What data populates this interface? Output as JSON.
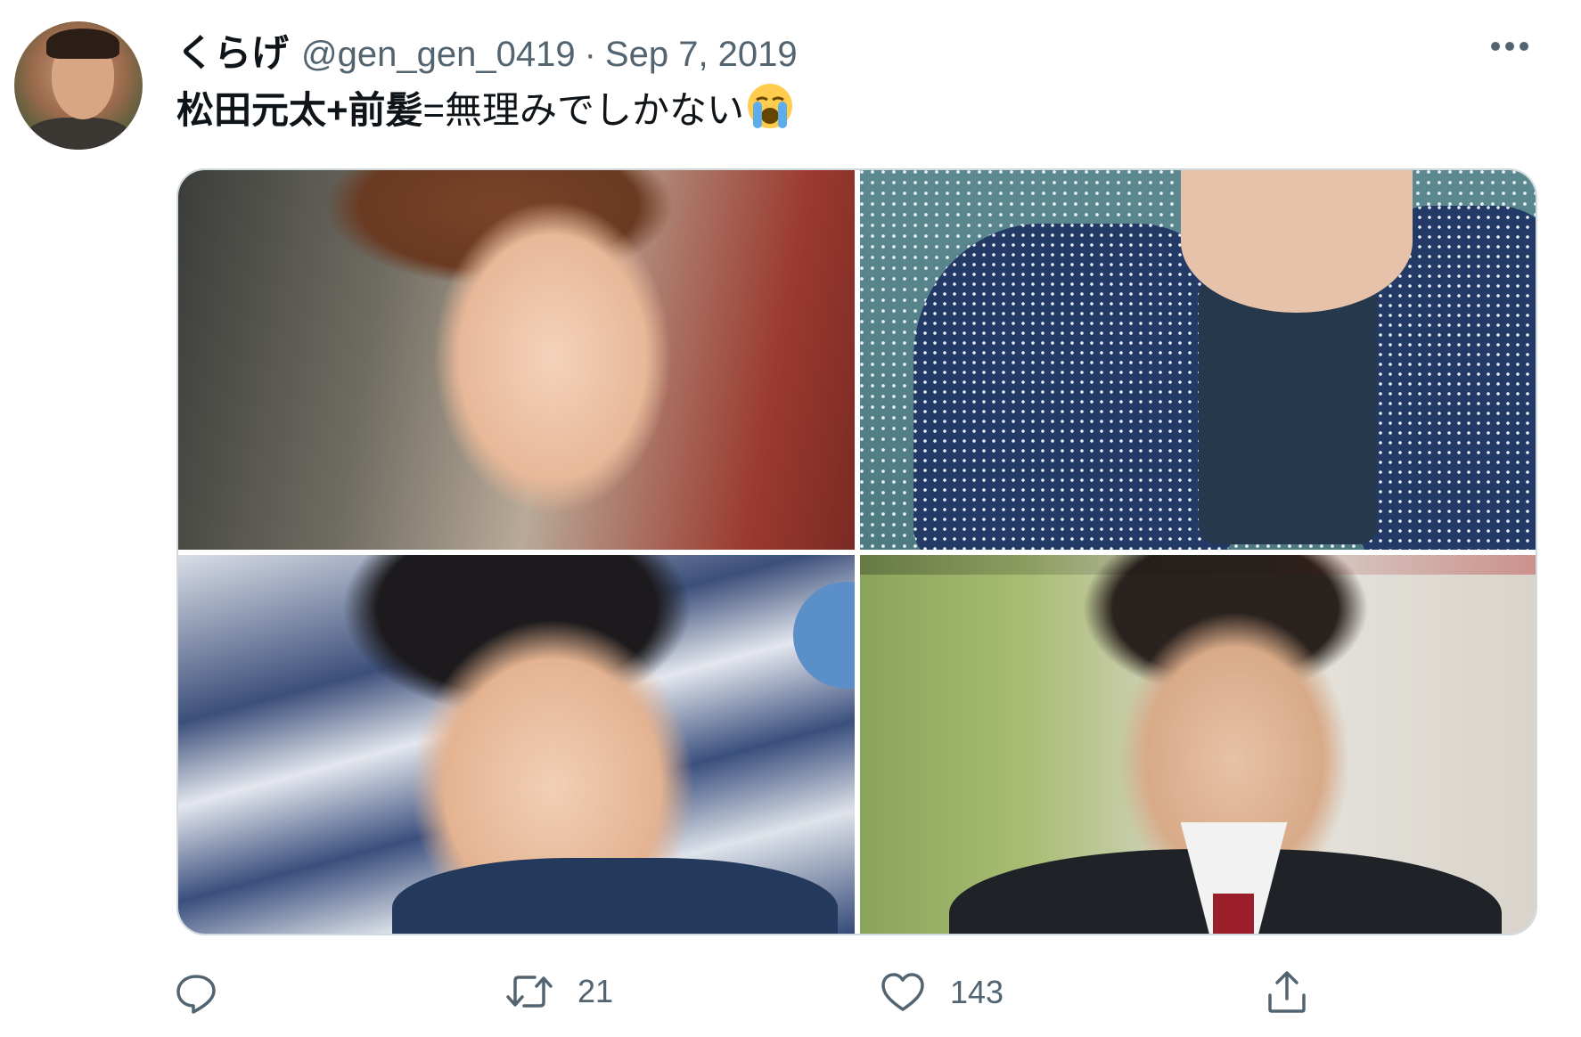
{
  "tweet": {
    "display_name": "くらげ",
    "handle": "@gen_gen_0419",
    "separator": "·",
    "date": "Sep 7, 2019",
    "text_bold": "松田元太+前髪",
    "text_rest": "=無理みでしかない",
    "emoji": "loudly-crying-face-emoji"
  },
  "media": {
    "photos": [
      {
        "name": "photo-1"
      },
      {
        "name": "photo-2"
      },
      {
        "name": "photo-3"
      },
      {
        "name": "photo-4"
      }
    ]
  },
  "actions": {
    "reply_count": "",
    "retweet_count": "21",
    "like_count": "143"
  },
  "icons": {
    "more": "more-horizontal-icon",
    "reply": "reply-icon",
    "retweet": "retweet-icon",
    "like": "heart-icon",
    "share": "share-icon"
  },
  "colors": {
    "text_primary": "#0f1419",
    "text_secondary": "#536471",
    "border": "#cfd9de"
  }
}
